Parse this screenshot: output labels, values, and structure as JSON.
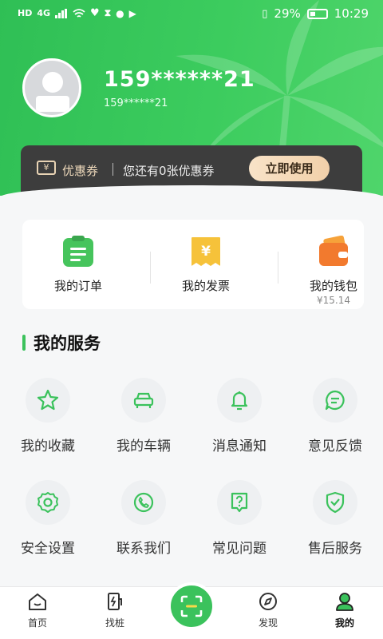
{
  "status_bar": {
    "left_items": [
      "HD",
      "4G"
    ],
    "battery": "29%",
    "time": "10:29"
  },
  "profile": {
    "phone": "159******21",
    "phone_sub": "159******21"
  },
  "coupon": {
    "title": "优惠券",
    "icon_text": "¥",
    "text": "您还有0张优惠券",
    "button": "立即使用"
  },
  "quick": [
    {
      "label": "我的订单",
      "icon": "order-icon",
      "color": "#46c45c"
    },
    {
      "label": "我的发票",
      "icon": "invoice-icon",
      "color": "#f6c23a"
    },
    {
      "label": "我的钱包",
      "icon": "wallet-icon",
      "color": "#f27a2e",
      "value": "¥15.14"
    }
  ],
  "services_title": "我的服务",
  "services": [
    {
      "label": "我的收藏",
      "icon": "star-icon"
    },
    {
      "label": "我的车辆",
      "icon": "car-icon"
    },
    {
      "label": "消息通知",
      "icon": "bell-icon"
    },
    {
      "label": "意见反馈",
      "icon": "feedback-icon"
    },
    {
      "label": "安全设置",
      "icon": "gear-icon"
    },
    {
      "label": "联系我们",
      "icon": "phone-icon"
    },
    {
      "label": "常见问题",
      "icon": "question-icon"
    },
    {
      "label": "售后服务",
      "icon": "shield-icon"
    }
  ],
  "tabs": [
    {
      "label": "首页",
      "icon": "home-icon"
    },
    {
      "label": "找桩",
      "icon": "charger-icon"
    },
    {
      "label": "",
      "icon": "scan-icon"
    },
    {
      "label": "发现",
      "icon": "compass-icon"
    },
    {
      "label": "我的",
      "icon": "user-icon",
      "active": true
    }
  ],
  "colors": {
    "accent": "#3bc25c",
    "coupon_bg": "#3d3d3d"
  }
}
